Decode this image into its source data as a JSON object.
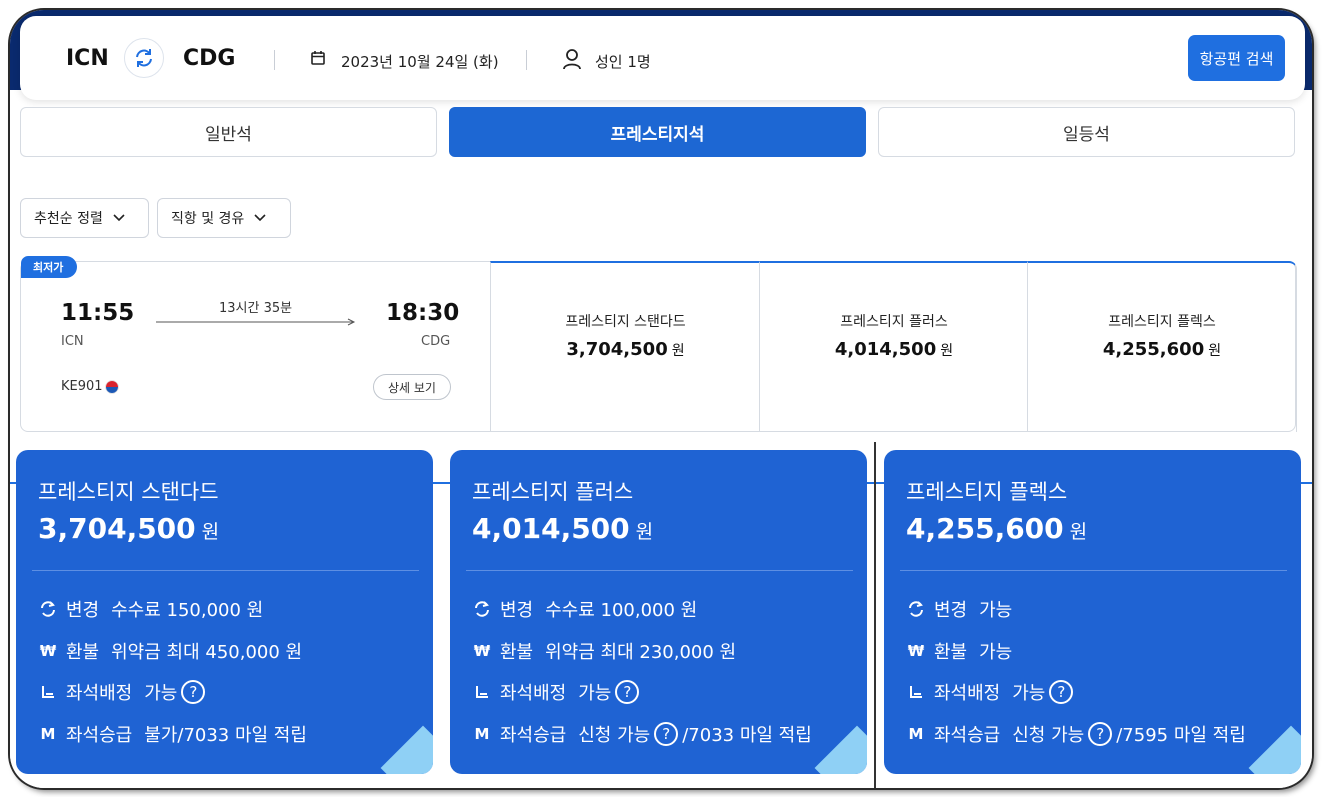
{
  "search": {
    "origin": "ICN",
    "destination": "CDG",
    "date": "2023년 10월 24일 (화)",
    "passengers": "성인 1명",
    "search_button": "항공편 검색"
  },
  "cabin_tabs": [
    {
      "label": "일반석",
      "selected": false
    },
    {
      "label": "프레스티지석",
      "selected": true
    },
    {
      "label": "일등석",
      "selected": false
    }
  ],
  "filters": {
    "sort": "추천순 정렬",
    "stops": "직항 및 경유"
  },
  "flight": {
    "badge": "최저가",
    "departure_time": "11:55",
    "arrival_time": "18:30",
    "departure_code": "ICN",
    "arrival_code": "CDG",
    "duration": "13시간 35분",
    "flight_number": "KE901",
    "detail_button": "상세 보기",
    "fares": [
      {
        "name": "프레스티지 스탠다드",
        "price": "3,704,500",
        "currency": "원"
      },
      {
        "name": "프레스티지 플러스",
        "price": "4,014,500",
        "currency": "원"
      },
      {
        "name": "프레스티지 플렉스",
        "price": "4,255,600",
        "currency": "원"
      }
    ]
  },
  "fare_cards": [
    {
      "title": "프레스티지 스탠다드",
      "price": "3,704,500",
      "currency": "원",
      "change_label": "변경",
      "change_value": "수수료 150,000 원",
      "refund_label": "환불",
      "refund_value": "위약금 최대 450,000 원",
      "seat_label": "좌석배정",
      "seat_value": "가능",
      "upgrade_label": "좌석승급",
      "upgrade_value": "불가",
      "miles": "/7033 마일 적립"
    },
    {
      "title": "프레스티지 플러스",
      "price": "4,014,500",
      "currency": "원",
      "change_label": "변경",
      "change_value": "수수료 100,000 원",
      "refund_label": "환불",
      "refund_value": "위약금 최대 230,000 원",
      "seat_label": "좌석배정",
      "seat_value": "가능",
      "upgrade_label": "좌석승급",
      "upgrade_value": "신청 가능",
      "miles": "/7033 마일 적립"
    },
    {
      "title": "프레스티지 플렉스",
      "price": "4,255,600",
      "currency": "원",
      "change_label": "변경",
      "change_value": "가능",
      "refund_label": "환불",
      "refund_value": "가능",
      "seat_label": "좌석배정",
      "seat_value": "가능",
      "upgrade_label": "좌석승급",
      "upgrade_value": "신청 가능",
      "miles": "/7595 마일 적립"
    }
  ],
  "icons": {
    "swap": "swap-icon",
    "calendar": "calendar-icon",
    "person": "person-icon",
    "chevron": "chevron-down-icon",
    "flag": "korean-air-logo-icon",
    "change": "change-icon",
    "refund": "won-icon",
    "seat": "seat-icon",
    "upgrade": "miles-icon",
    "help": "question-icon"
  },
  "colors": {
    "primary": "#1f6fe0",
    "card_blue": "#1f63d3",
    "accent_light": "#8fd0f5",
    "header_dark": "#0a2a6e"
  }
}
